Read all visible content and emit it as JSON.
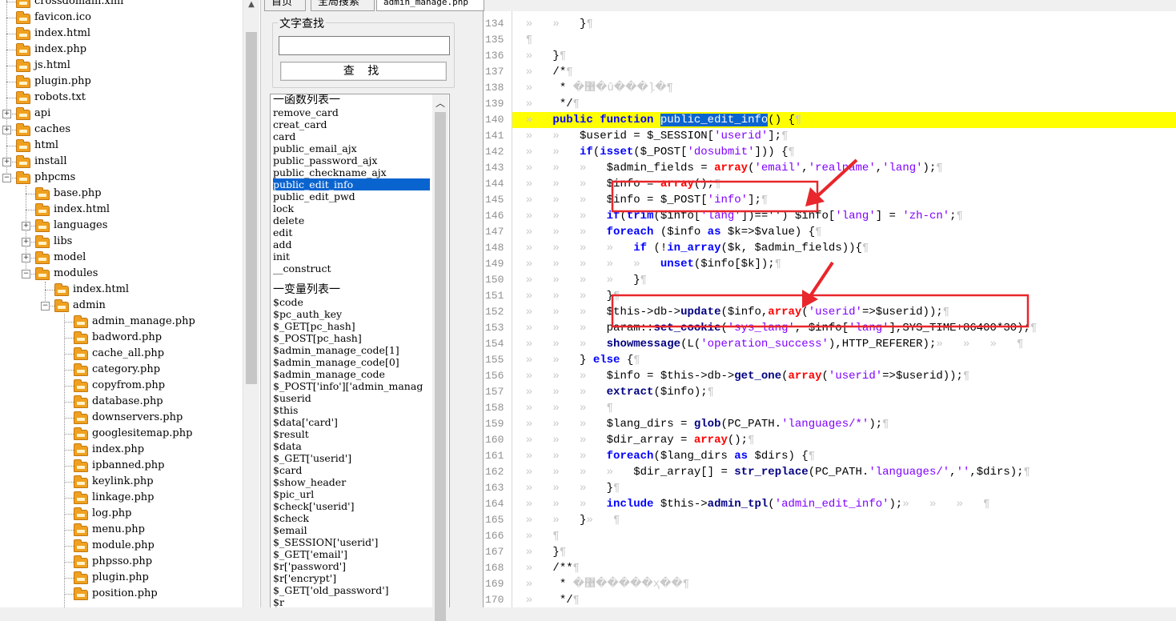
{
  "tree": {
    "items": [
      {
        "label": "crossdomain.xml",
        "depth": 1,
        "folder": false
      },
      {
        "label": "favicon.ico",
        "depth": 1,
        "folder": false
      },
      {
        "label": "index.html",
        "depth": 1,
        "folder": false
      },
      {
        "label": "index.php",
        "depth": 1,
        "folder": false
      },
      {
        "label": "js.html",
        "depth": 1,
        "folder": false
      },
      {
        "label": "plugin.php",
        "depth": 1,
        "folder": false
      },
      {
        "label": "robots.txt",
        "depth": 1,
        "folder": false
      },
      {
        "label": "api",
        "depth": 1,
        "folder": true,
        "expander": "+"
      },
      {
        "label": "caches",
        "depth": 1,
        "folder": true,
        "expander": "+"
      },
      {
        "label": "html",
        "depth": 1,
        "folder": true
      },
      {
        "label": "install",
        "depth": 1,
        "folder": true,
        "expander": "+"
      },
      {
        "label": "phpcms",
        "depth": 1,
        "folder": true,
        "expander": "-"
      },
      {
        "label": "base.php",
        "depth": 2,
        "folder": false
      },
      {
        "label": "index.html",
        "depth": 2,
        "folder": false
      },
      {
        "label": "languages",
        "depth": 2,
        "folder": true,
        "expander": "+"
      },
      {
        "label": "libs",
        "depth": 2,
        "folder": true,
        "expander": "+"
      },
      {
        "label": "model",
        "depth": 2,
        "folder": true,
        "expander": "+"
      },
      {
        "label": "modules",
        "depth": 2,
        "folder": true,
        "expander": "-"
      },
      {
        "label": "index.html",
        "depth": 3,
        "folder": false
      },
      {
        "label": "admin",
        "depth": 3,
        "folder": true,
        "expander": "-"
      },
      {
        "label": "admin_manage.php",
        "depth": 4,
        "folder": false
      },
      {
        "label": "badword.php",
        "depth": 4,
        "folder": false
      },
      {
        "label": "cache_all.php",
        "depth": 4,
        "folder": false
      },
      {
        "label": "category.php",
        "depth": 4,
        "folder": false
      },
      {
        "label": "copyfrom.php",
        "depth": 4,
        "folder": false
      },
      {
        "label": "database.php",
        "depth": 4,
        "folder": false
      },
      {
        "label": "downservers.php",
        "depth": 4,
        "folder": false
      },
      {
        "label": "googlesitemap.php",
        "depth": 4,
        "folder": false
      },
      {
        "label": "index.php",
        "depth": 4,
        "folder": false
      },
      {
        "label": "ipbanned.php",
        "depth": 4,
        "folder": false
      },
      {
        "label": "keylink.php",
        "depth": 4,
        "folder": false
      },
      {
        "label": "linkage.php",
        "depth": 4,
        "folder": false
      },
      {
        "label": "log.php",
        "depth": 4,
        "folder": false
      },
      {
        "label": "menu.php",
        "depth": 4,
        "folder": false
      },
      {
        "label": "module.php",
        "depth": 4,
        "folder": false
      },
      {
        "label": "phpsso.php",
        "depth": 4,
        "folder": false
      },
      {
        "label": "plugin.php",
        "depth": 4,
        "folder": false
      },
      {
        "label": "position.php",
        "depth": 4,
        "folder": false
      }
    ]
  },
  "tabs": [
    {
      "label": "首页"
    },
    {
      "label": "全局搜索"
    },
    {
      "label": "admin_manage.php"
    }
  ],
  "search": {
    "legend": "文字查找",
    "value": "",
    "button_label": "查 找"
  },
  "symbols": {
    "functions_header": "一函数列表一",
    "functions": [
      "remove_card",
      "creat_card",
      "card",
      "public_email_ajx",
      "public_password_ajx",
      "public_checkname_ajx",
      "public_edit_info",
      "public_edit_pwd",
      "lock",
      "delete",
      "edit",
      "add",
      "init",
      "__construct"
    ],
    "selected_function": "public_edit_info",
    "variables_header": "一变量列表一",
    "variables": [
      "$code",
      "$pc_auth_key",
      "$_GET[pc_hash]",
      "$_POST[pc_hash]",
      "$admin_manage_code[1]",
      "$admin_manage_code[0]",
      "$admin_manage_code",
      "$_POST['info']['admin_manag",
      "$userid",
      "$this",
      "$data['card']",
      "$result",
      "$data",
      "$_GET['userid']",
      "$card",
      "$show_header",
      "$pic_url",
      "$check['userid']",
      "$check",
      "$email",
      "$_SESSION['userid']",
      "$_GET['email']",
      "$r['password']",
      "$r['encrypt']",
      "$_GET['old_password']",
      "$r"
    ]
  },
  "editor": {
    "line_numbers": [
      "134",
      "135",
      "136",
      "137",
      "138",
      "139",
      "140",
      "141",
      "142",
      "143",
      "144",
      "145",
      "146",
      "147",
      "148",
      "149",
      "150",
      "151",
      "152",
      "153",
      "154",
      "155",
      "156",
      "157",
      "158",
      "159",
      "160",
      "161",
      "162",
      "163",
      "164",
      "165",
      "166",
      "167",
      "168",
      "169",
      "170"
    ],
    "highlighted_line": "140"
  },
  "colors": {
    "keyword": "#0000ff",
    "string": "#8000ff",
    "array_keyword": "#ff0000",
    "highlight": "#ffff00",
    "selection": "#0a64d0",
    "annotation": "#e8262b"
  }
}
